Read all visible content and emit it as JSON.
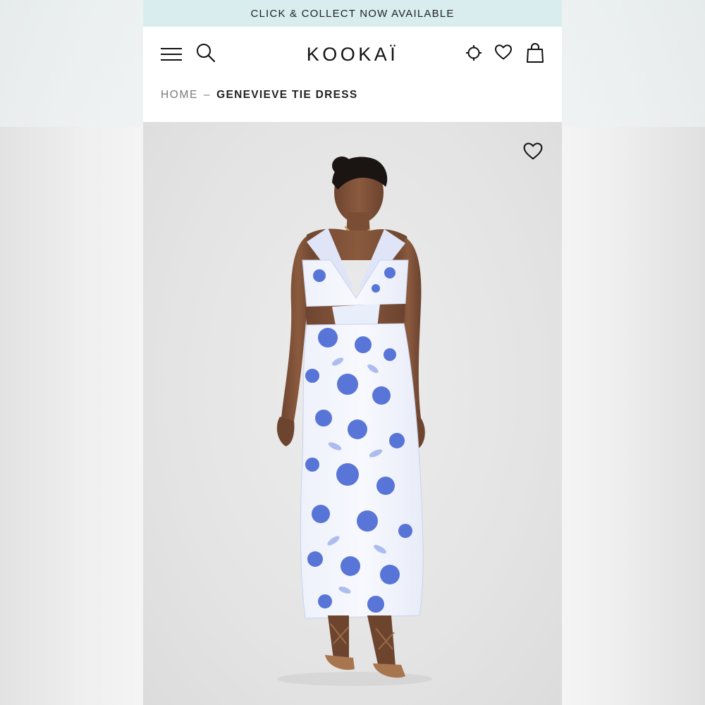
{
  "promo": {
    "text": "CLICK & COLLECT NOW AVAILABLE"
  },
  "header": {
    "logo": "KOOKAÏ",
    "icons": [
      "menu-icon",
      "search-icon",
      "store-locator-icon",
      "wishlist-icon",
      "shopping-bag-icon"
    ]
  },
  "breadcrumb": {
    "home": "HOME",
    "separator": "–",
    "current": "GENEVIEVE TIE DRESS"
  },
  "product": {
    "favorite_icon": "heart-outline-icon"
  },
  "colors": {
    "promo_bg": "#d9edee",
    "text": "#111111",
    "muted": "#7a7a7a",
    "image_bg": "#e6e6e6",
    "print_blue": "#3d5fd1"
  }
}
